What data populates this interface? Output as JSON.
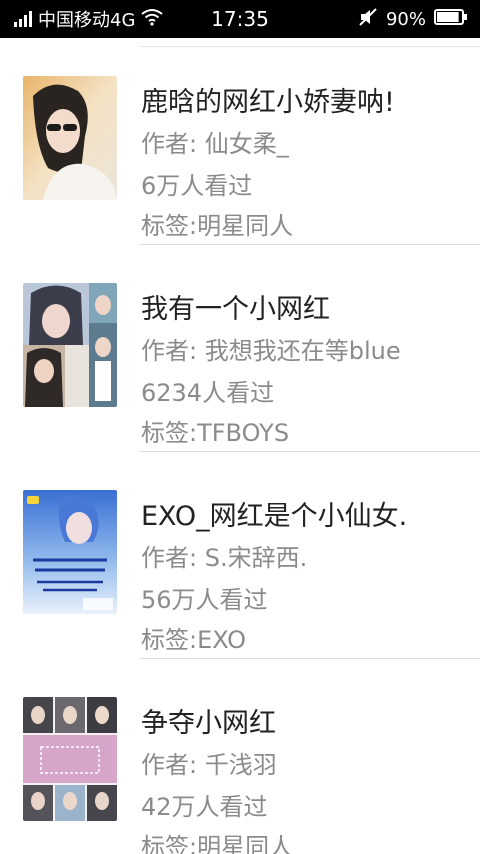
{
  "status_bar": {
    "carrier": "中国移动4G",
    "time": "17:35",
    "battery_percent": "90%",
    "battery_level": 0.9,
    "icons": [
      "signal-icon",
      "wifi-icon",
      "mute-icon",
      "battery-icon"
    ]
  },
  "books": [
    {
      "title": "鹿晗的网红小娇妻呐!",
      "author": "作者: 仙女柔_",
      "views": "6万人看过",
      "tags": "标签:明星同人"
    },
    {
      "title": "我有一个小网红",
      "author": "作者: 我想我还在等blue",
      "views": "6234人看过",
      "tags": "标签:TFBOYS"
    },
    {
      "title": "EXO_网红是个小仙女.",
      "author": "作者: S.宋辞西.",
      "views": "56万人看过",
      "tags": "标签:EXO"
    },
    {
      "title": "争夺小网红",
      "author": "作者: 千浅羽",
      "views": "42万人看过",
      "tags": "标签:明星同人"
    }
  ],
  "colors": {
    "title_text": "#222222",
    "meta_text": "#8b8b8b",
    "divider": "#dcdcdc",
    "status_bar_bg": "#000000"
  }
}
